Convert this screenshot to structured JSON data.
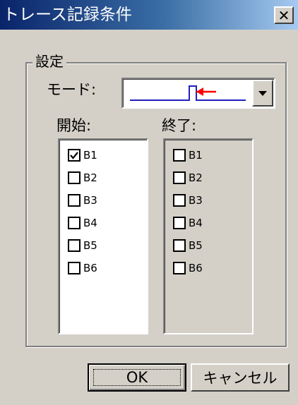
{
  "window": {
    "title": "トレース記録条件",
    "close_symbol": "✕"
  },
  "settings": {
    "group_label": "設定",
    "mode_label": "モード:",
    "mode_value_icon": "rising-edge-arrow-waveform",
    "colors": {
      "waveform": "#2020c0",
      "arrow": "#ff0000"
    }
  },
  "start": {
    "label": "開始:",
    "items": [
      {
        "label": "B1",
        "checked": true
      },
      {
        "label": "B2",
        "checked": false
      },
      {
        "label": "B3",
        "checked": false
      },
      {
        "label": "B4",
        "checked": false
      },
      {
        "label": "B5",
        "checked": false
      },
      {
        "label": "B6",
        "checked": false
      }
    ]
  },
  "end": {
    "label": "終了:",
    "items": [
      {
        "label": "B1",
        "checked": false
      },
      {
        "label": "B2",
        "checked": false
      },
      {
        "label": "B3",
        "checked": false
      },
      {
        "label": "B4",
        "checked": false
      },
      {
        "label": "B5",
        "checked": false
      },
      {
        "label": "B6",
        "checked": false
      }
    ]
  },
  "buttons": {
    "ok": "OK",
    "cancel": "キャンセル"
  }
}
